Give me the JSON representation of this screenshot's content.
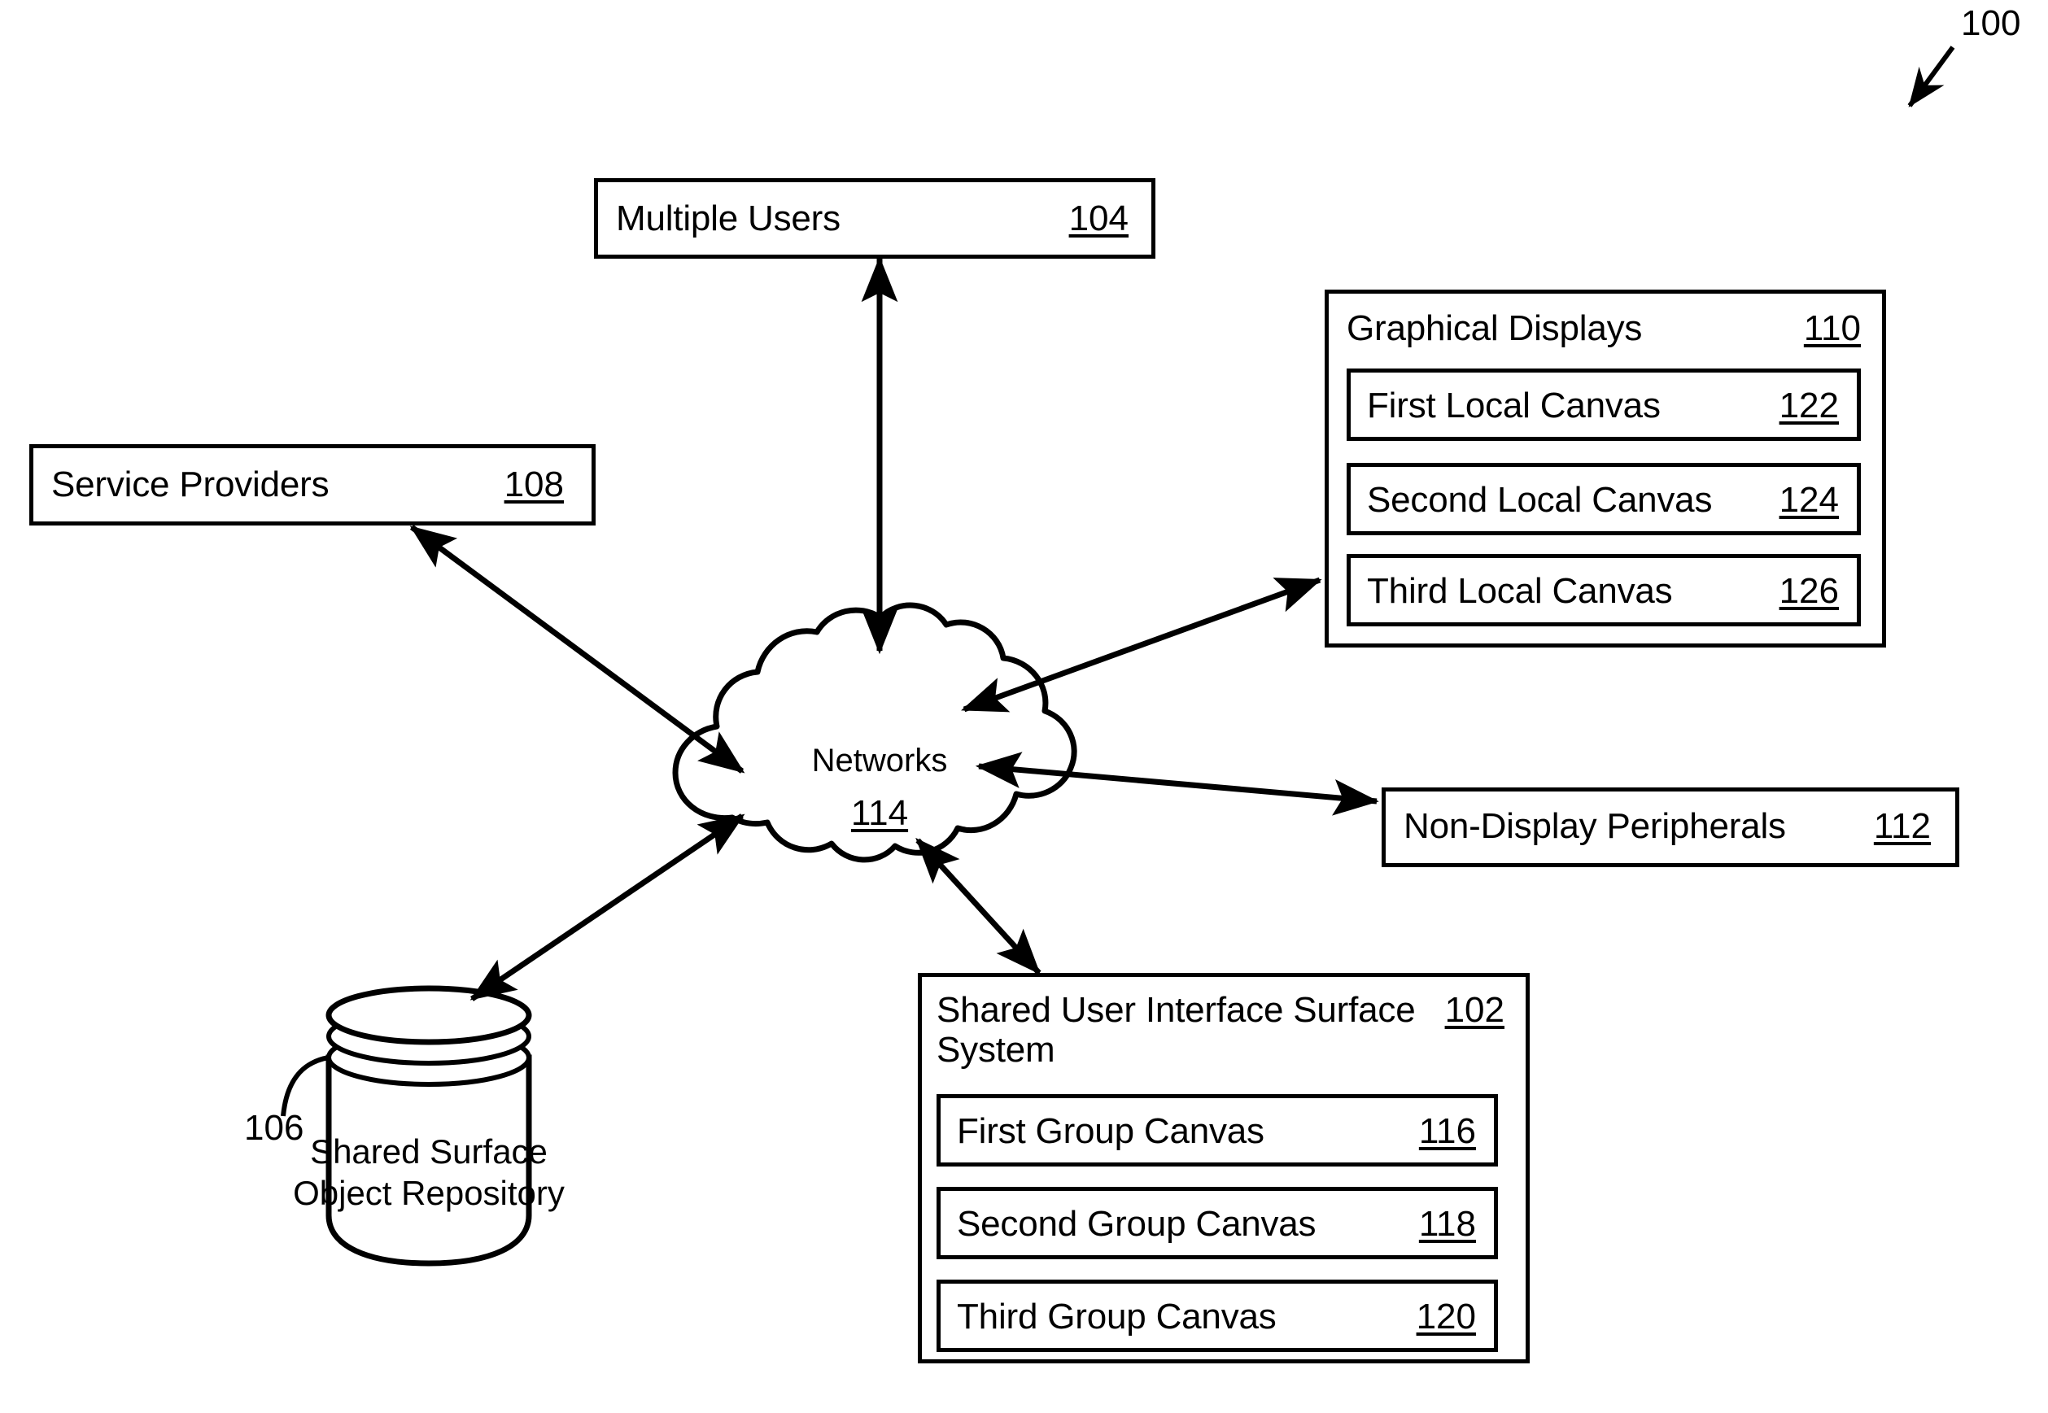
{
  "figure": {
    "figure_number": "100",
    "background_color": "#ffffff",
    "line_color": "#000000"
  },
  "nodes": {
    "multiple_users": {
      "label": "Multiple Users",
      "ref": "104"
    },
    "service_providers": {
      "label": "Service Providers",
      "ref": "108"
    },
    "graphical_displays": {
      "label": "Graphical Displays",
      "ref": "110",
      "children": [
        {
          "label": "First Local Canvas",
          "ref": "122"
        },
        {
          "label": "Second Local Canvas",
          "ref": "124"
        },
        {
          "label": "Third Local Canvas",
          "ref": "126"
        }
      ]
    },
    "non_display_peripherals": {
      "label": "Non-Display Peripherals",
      "ref": "112"
    },
    "networks": {
      "label": "Networks",
      "ref": "114"
    },
    "shared_surface_object_repository": {
      "label": "Shared Surface\nObject Repository",
      "ref": "106"
    },
    "shared_ui_surface_system": {
      "label": "Shared User Interface Surface\nSystem",
      "ref": "102",
      "children": [
        {
          "label": "First Group Canvas",
          "ref": "116"
        },
        {
          "label": "Second Group Canvas",
          "ref": "118"
        },
        {
          "label": "Third Group Canvas",
          "ref": "120"
        }
      ]
    }
  },
  "connectors": [
    {
      "from": "networks",
      "to": "multiple_users",
      "arrow": "double"
    },
    {
      "from": "networks",
      "to": "service_providers",
      "arrow": "double"
    },
    {
      "from": "networks",
      "to": "graphical_displays",
      "arrow": "double"
    },
    {
      "from": "networks",
      "to": "non_display_peripherals",
      "arrow": "double"
    },
    {
      "from": "networks",
      "to": "shared_surface_object_repository",
      "arrow": "double"
    },
    {
      "from": "networks",
      "to": "shared_ui_surface_system",
      "arrow": "double"
    },
    {
      "from": "figure_label",
      "to": "diagram",
      "arrow": "single"
    }
  ]
}
